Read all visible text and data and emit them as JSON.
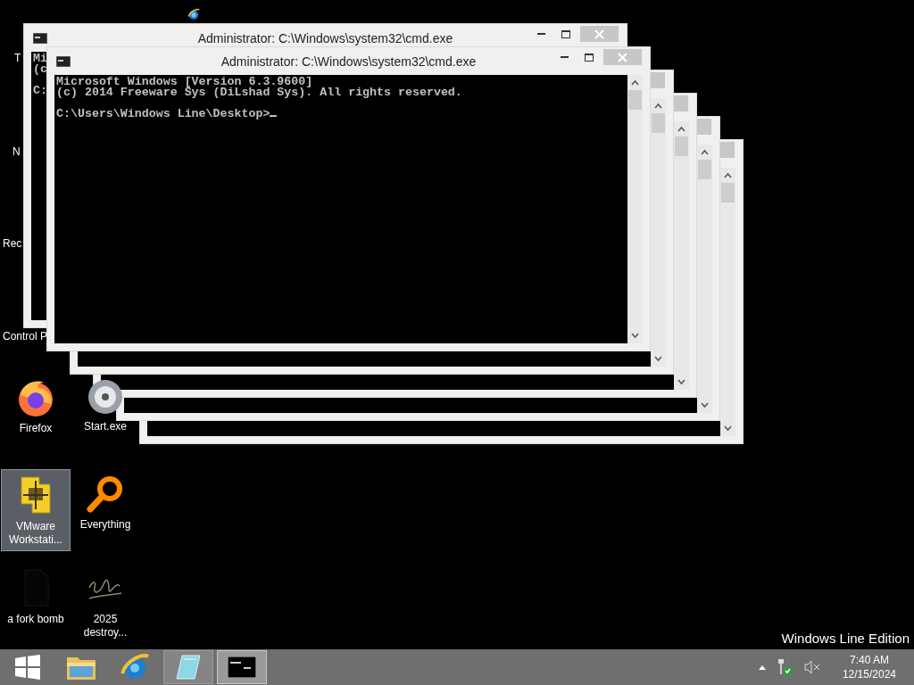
{
  "desktop": {
    "icons": [
      {
        "kind": "ie",
        "selected": false
      },
      {
        "kind": "text",
        "label": "T",
        "selected": false
      },
      {
        "kind": "text",
        "label": "N",
        "selected": false
      },
      {
        "kind": "text",
        "label": "Rec",
        "selected": false
      },
      {
        "kind": "text",
        "label": "Control P",
        "selected": false
      },
      {
        "kind": "firefox",
        "label": "Firefox",
        "selected": false
      },
      {
        "kind": "start",
        "label": "Start.exe",
        "selected": false
      },
      {
        "kind": "vmware",
        "label": "VMware Workstati...",
        "selected": true
      },
      {
        "kind": "everything",
        "label": "Everything",
        "selected": false
      },
      {
        "kind": "blank",
        "label": "a fork bomb",
        "selected": false
      },
      {
        "kind": "scribble",
        "label": "2025 destroy...",
        "selected": false
      }
    ],
    "edition_text": "Windows Line Edition"
  },
  "ghost_windows": [
    {
      "kind": "frame"
    },
    {
      "kind": "frame"
    },
    {
      "kind": "frame"
    },
    {
      "kind": "frame"
    }
  ],
  "windows": [
    {
      "title": "Administrator: C:\\Windows\\system32\\cmd.exe",
      "lines": [
        "Mi",
        "(c"
      ],
      "prompt": "C:",
      "scrollbar": false
    },
    {
      "title": "Administrator: C:\\Windows\\system32\\cmd.exe",
      "lines": [
        "Microsoft Windows [Version 6.3.9600]",
        "(c) 2014 Freeware Sys (DiLshad Sys). All rights reserved."
      ],
      "prompt": "C:\\Users\\Windows Line\\Desktop>",
      "cursor": true,
      "scrollbar": true
    }
  ],
  "taskbar": {
    "items": [
      {
        "kind": "start",
        "running": false,
        "selected": false
      },
      {
        "kind": "explorer",
        "running": false,
        "selected": false
      },
      {
        "kind": "ie",
        "running": false,
        "selected": false
      },
      {
        "kind": "notes",
        "running": true,
        "selected": false
      },
      {
        "kind": "cmd",
        "running": true,
        "selected": true
      }
    ],
    "tray": {
      "volume_muted": true,
      "time": "7:40 AM",
      "date": "12/15/2024"
    }
  }
}
